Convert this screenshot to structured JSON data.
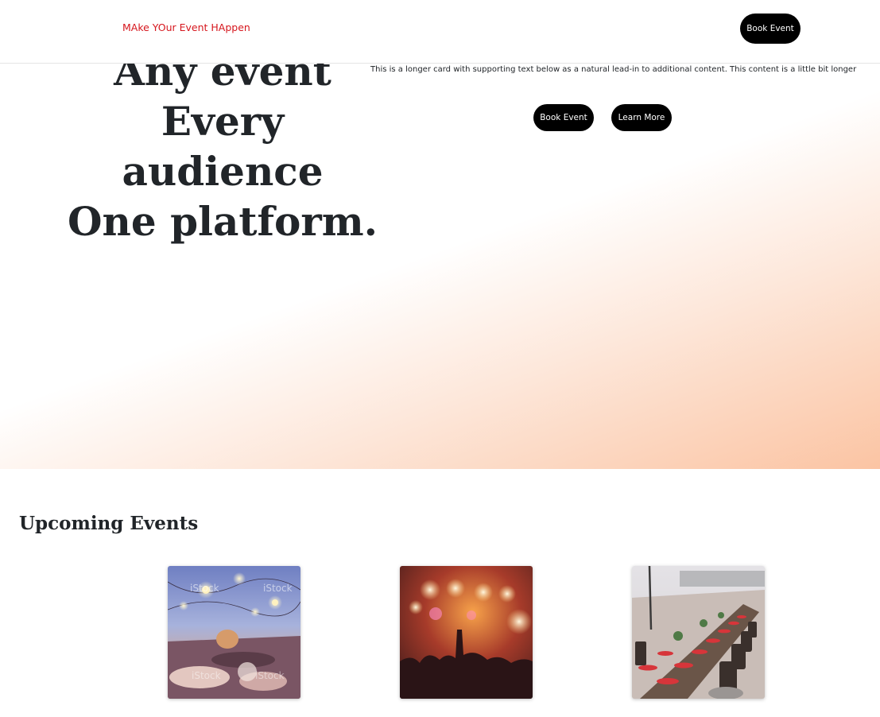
{
  "nav": {
    "brand": "MAke YOur Event HAppen",
    "book_label": "Book Event"
  },
  "hero": {
    "headline": [
      "Any event",
      "Every",
      "audience",
      "One platform."
    ],
    "lead": "This is a longer card with supporting text below as a natural lead-in to additional content. This content is a little bit longer",
    "book_label": "Book Event",
    "learn_label": "Learn More"
  },
  "events": {
    "title": "Upcoming Events",
    "cards": [
      {
        "image": "outdoor-string-lights-party-photo",
        "watermark": "iStock"
      },
      {
        "image": "concert-crowd-stage-lights-photo"
      },
      {
        "image": "beach-banquet-table-photo"
      }
    ]
  },
  "colors": {
    "brand": "#d6161d",
    "button": "#000000",
    "gradient": "#fbc4a3"
  }
}
